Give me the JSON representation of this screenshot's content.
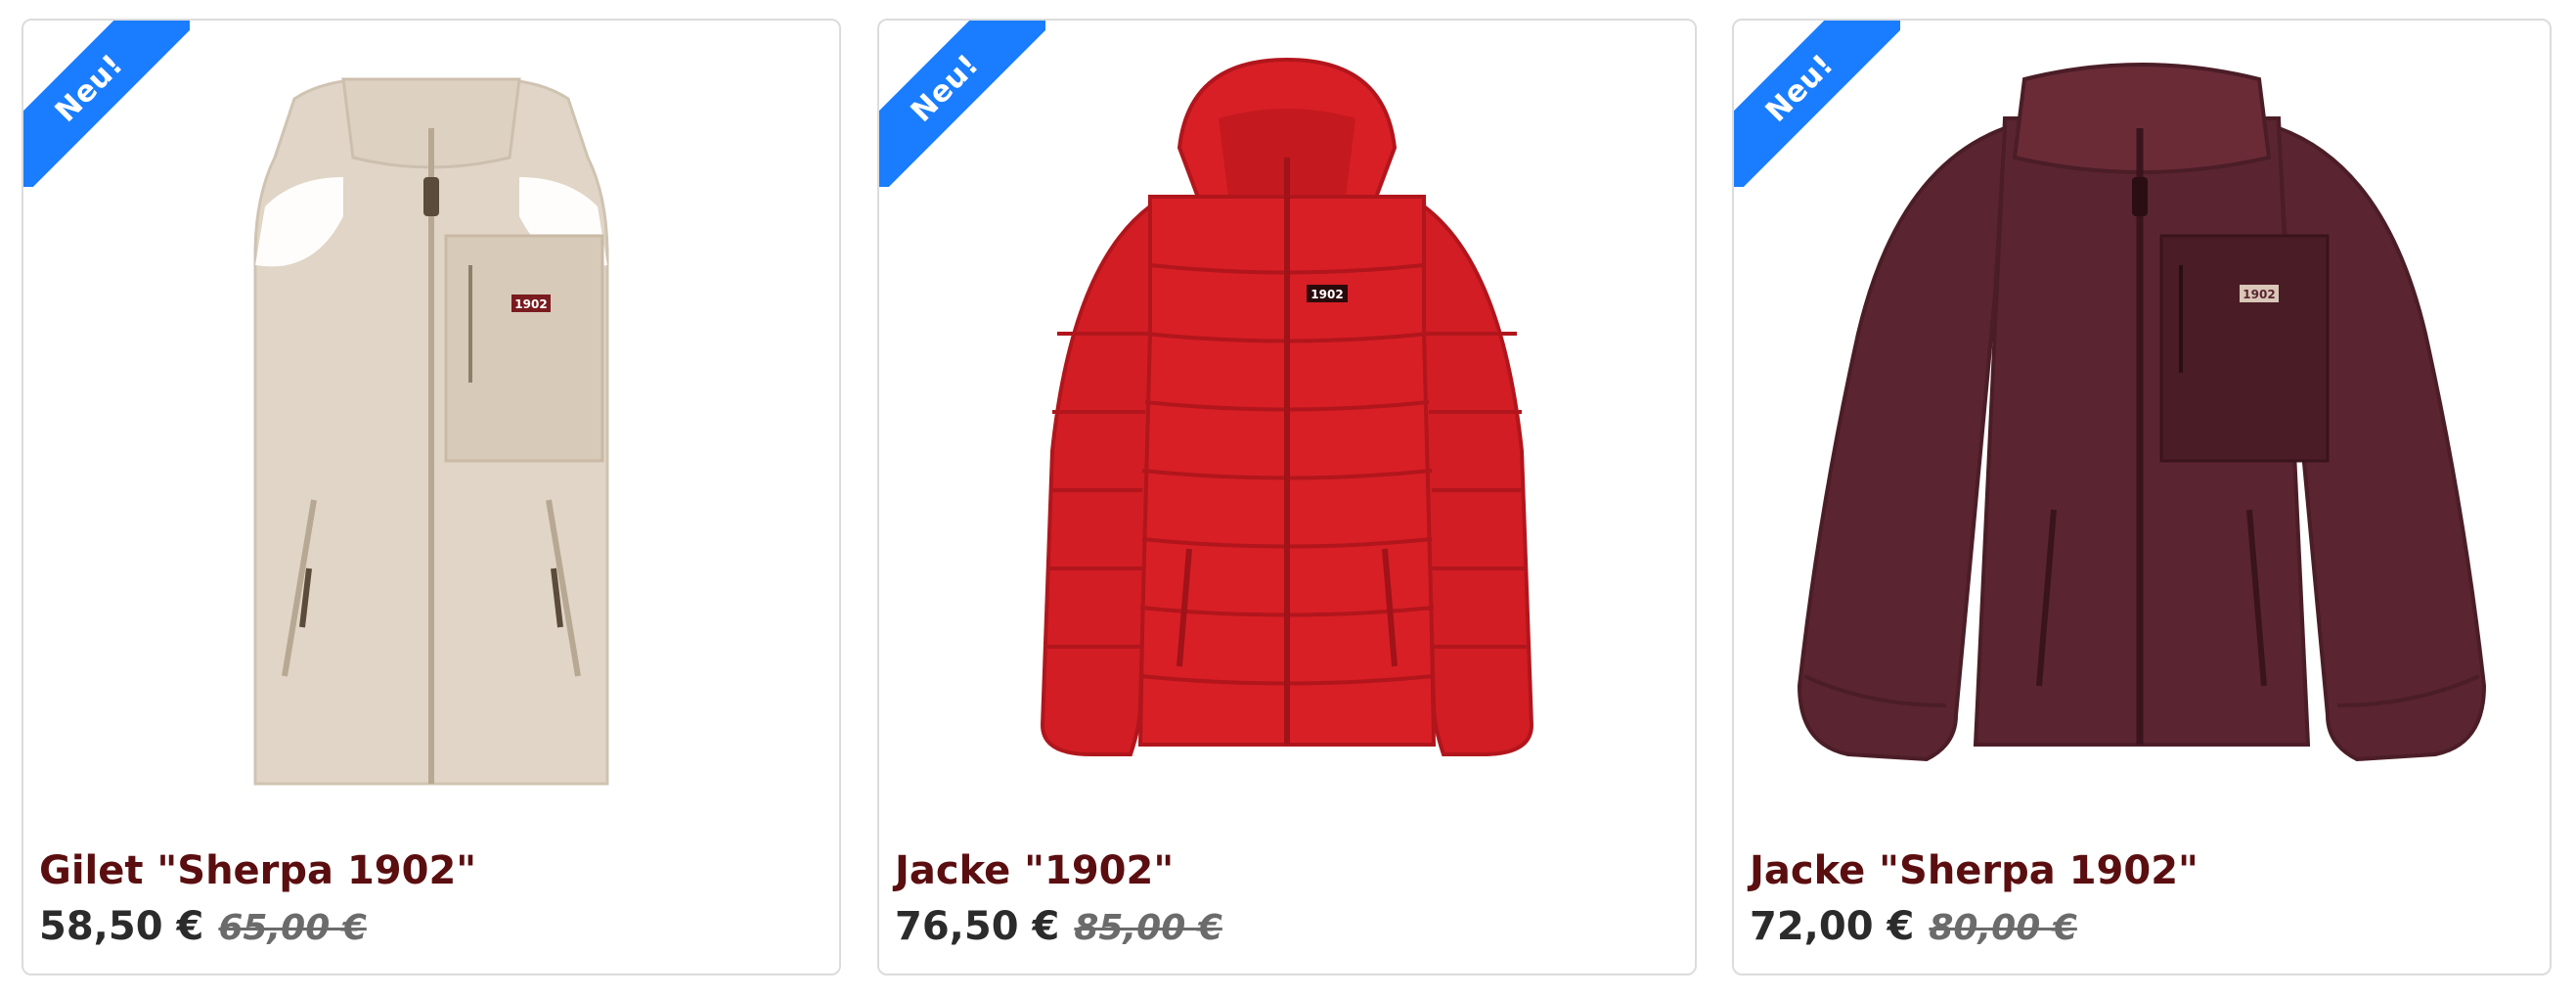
{
  "products": [
    {
      "badge": "Neu!",
      "title": "Gilet \"Sherpa 1902\"",
      "price": "58,50 €",
      "old_price": "65,00 €",
      "image_label": "1902",
      "color": "#e0d5c6"
    },
    {
      "badge": "Neu!",
      "title": "Jacke \"1902\"",
      "price": "76,50 €",
      "old_price": "85,00 €",
      "image_label": "1902",
      "color": "#d81f26"
    },
    {
      "badge": "Neu!",
      "title": "Jacke \"Sherpa 1902\"",
      "price": "72,00 €",
      "old_price": "80,00 €",
      "image_label": "1902",
      "color": "#5a2530"
    }
  ]
}
